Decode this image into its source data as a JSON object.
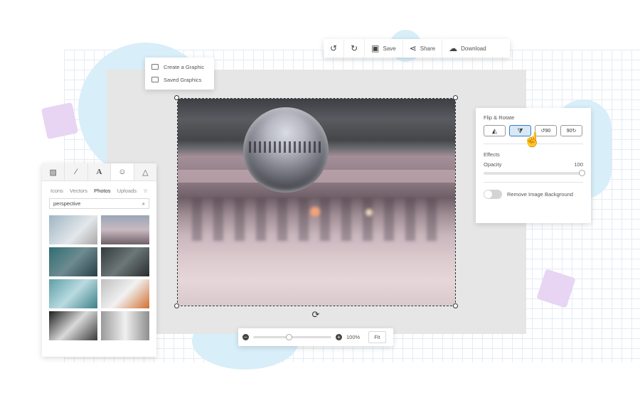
{
  "toolbar": {
    "undo_icon": "undo-icon",
    "redo_icon": "redo-icon",
    "save_label": "Save",
    "share_label": "Share",
    "download_label": "Download"
  },
  "create_menu": {
    "items": [
      {
        "label": "Create a Graphic",
        "icon": "image-icon"
      },
      {
        "label": "Saved Graphics",
        "icon": "folder-icon"
      }
    ]
  },
  "left_panel": {
    "tabs": [
      "image-icon",
      "magic-wand-icon",
      "text-icon",
      "smiley-icon",
      "triangle-icon"
    ],
    "categories": [
      "Icons",
      "Vectors",
      "Photos",
      "Uploads"
    ],
    "active_category": "Photos",
    "search_value": "perspective",
    "thumbnail_count": 8
  },
  "right_panel": {
    "flip_rotate_title": "Flip & Rotate",
    "effects_title": "Effects",
    "opacity_label": "Opacity",
    "opacity_value": "100",
    "opacity_fraction": 1.0,
    "remove_bg_label": "Remove Image Background",
    "remove_bg_enabled": false,
    "rotate_left_text": "90",
    "rotate_right_text": "90"
  },
  "zoom": {
    "value_label": "100%",
    "fit_label": "Fit",
    "slider_fraction": 0.45
  },
  "colors": {
    "accent": "#2f7fc4",
    "workspace": "#e6e6e6"
  }
}
